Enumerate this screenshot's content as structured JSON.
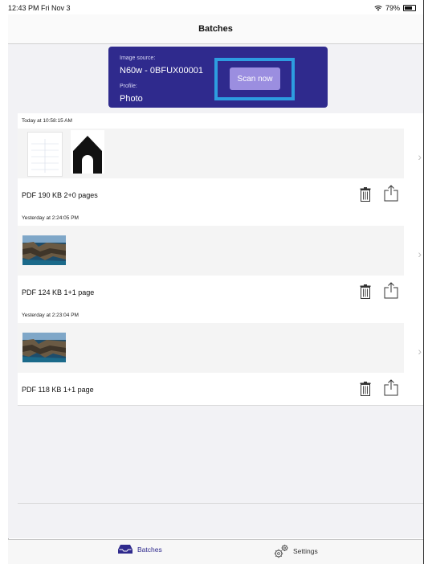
{
  "status_bar": {
    "time": "12:43 PM  Fri Nov 3",
    "battery": "79%",
    "battery_level": 0.79
  },
  "nav": {
    "title": "Batches"
  },
  "scan_card": {
    "image_source_label": "Image source:",
    "image_source_value": "N60w - 0BFUX00001",
    "profile_label": "Profile:",
    "profile_value": "Photo",
    "scan_button": "Scan now",
    "colors": {
      "card": "#2f2a8d",
      "button": "#9b8ee0",
      "highlight": "#2d9de0"
    }
  },
  "batches": [
    {
      "date": "Today at 10:58:15 AM",
      "info": "PDF  190 KB  2+0 pages",
      "thumbs": [
        "document-page",
        "house-silhouette"
      ]
    },
    {
      "date": "Yesterday at 2:24:05 PM",
      "info": "PDF  124 KB  1+1 page",
      "thumbs": [
        "sea-cliff-photo"
      ]
    },
    {
      "date": "Yesterday at 2:23:04 PM",
      "info": "PDF  118 KB  1+1 page",
      "thumbs": [
        "sea-cliff-photo"
      ]
    }
  ],
  "tabs": [
    {
      "label": "Batches",
      "icon": "tray-icon",
      "active": true
    },
    {
      "label": "Settings",
      "icon": "gears-icon",
      "active": false
    }
  ]
}
